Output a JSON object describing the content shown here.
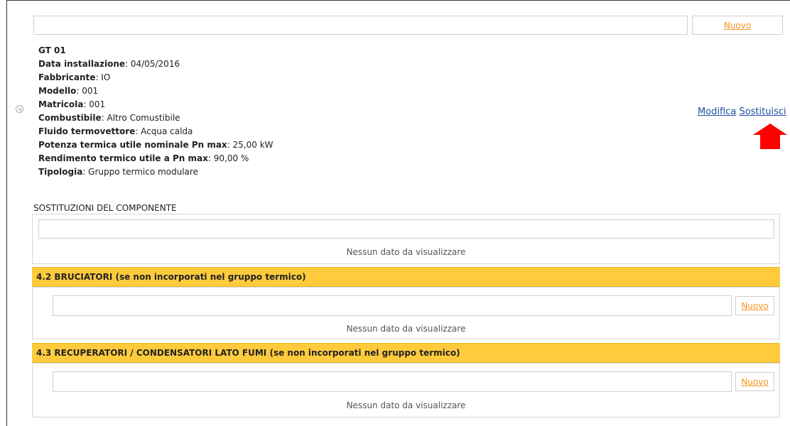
{
  "top": {
    "new_label": "Nuovo"
  },
  "component": {
    "code": "GT 01",
    "fields": [
      {
        "label": "Data installazione",
        "value": "04/05/2016"
      },
      {
        "label": "Fabbricante",
        "value": "IO"
      },
      {
        "label": "Modello",
        "value": "001"
      },
      {
        "label": "Matricola",
        "value": "001"
      },
      {
        "label": "Combustibile",
        "value": "Altro Comustibile"
      },
      {
        "label": "Fluido termovettore",
        "value": "Acqua calda"
      },
      {
        "label": "Potenza termica utile nominale Pn max",
        "value": "25,00 kW"
      },
      {
        "label": "Rendimento termico utile a Pn max",
        "value": "90,00 %"
      },
      {
        "label": "Tipologia",
        "value": "Gruppo termico modulare"
      }
    ],
    "actions": {
      "edit_label": "Modifica",
      "replace_label": "Sostituisci"
    }
  },
  "replacements": {
    "label": "SOSTITUZIONI DEL COMPONENTE",
    "empty_message": "Nessun dato da visualizzare"
  },
  "sections": [
    {
      "title": "4.2 BRUCIATORI (se non incorporati nel gruppo termico)",
      "new_label": "Nuovo",
      "empty_message": "Nessun dato da visualizzare"
    },
    {
      "title": "4.3 RECUPERATORI / CONDENSATORI LATO FUMI (se non incorporati nel gruppo termico)",
      "new_label": "Nuovo",
      "empty_message": "Nessun dato da visualizzare"
    }
  ],
  "colors": {
    "link_orange": "#f7941d",
    "link_blue": "#1c4fa1",
    "section_header": "#ffcb3c",
    "annotation_arrow": "#ff0000"
  }
}
